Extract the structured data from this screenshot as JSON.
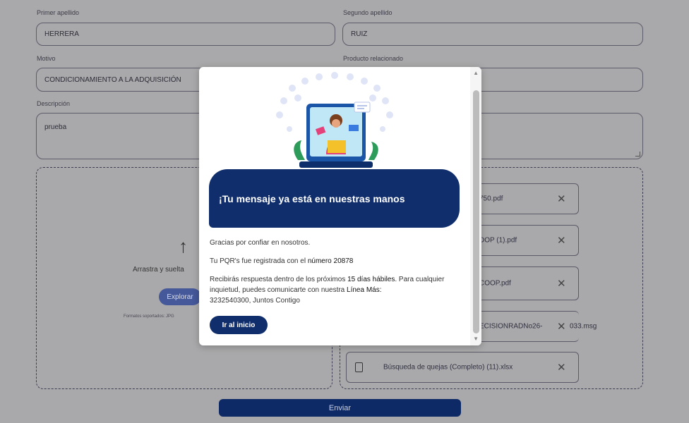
{
  "form": {
    "first_surname_label": "Primer apellido",
    "first_surname_value": "HERRERA",
    "second_surname_label": "Segundo apellido",
    "second_surname_value": "RUIZ",
    "reason_label": "Motivo",
    "reason_value": "CONDICIONAMIENTO A LA ADQUISICIÓN",
    "product_label": "Producto relacionado",
    "product_value": "",
    "description_label": "Descripción",
    "description_value": "prueba",
    "upload_drag_text": "Arrastra y suelta",
    "upload_button": "Explorar",
    "upload_formats": "Formatos soportados: JPG",
    "files": [
      {
        "name": "750.pdf"
      },
      {
        "name": "DOP (1).pdf"
      },
      {
        "name": "COOP.pdf"
      },
      {
        "name": "ECISIONRADNo26-",
        "extra": "033.msg"
      },
      {
        "name": "Búsqueda de quejas (Completo) (11).xlsx"
      }
    ],
    "submit_button": "Enviar"
  },
  "modal": {
    "title": "¡Tu mensaje ya está en nuestras manos",
    "thanks": "Gracias por confiar en nosotros.",
    "registered_prefix": "Tu PQR's fue registrada con el ",
    "registered_number": "número 20878",
    "response_1": "Recibirás respuesta dentro de los próximos ",
    "response_days": "15 días hábiles",
    "response_2": ". Para cualquier inquietud, puedes comunicarte con nuestra ",
    "response_line": "Línea Más:",
    "response_phone": "3232540300, Juntos Contigo",
    "home_button": "Ir al inicio"
  },
  "colors": {
    "brand_navy": "#102e6c",
    "overlay_gray": "#a9a9ab"
  },
  "icons": [
    "upload-arrow-icon",
    "close-icon",
    "document-icon",
    "scroll-up-icon",
    "scroll-down-icon"
  ]
}
